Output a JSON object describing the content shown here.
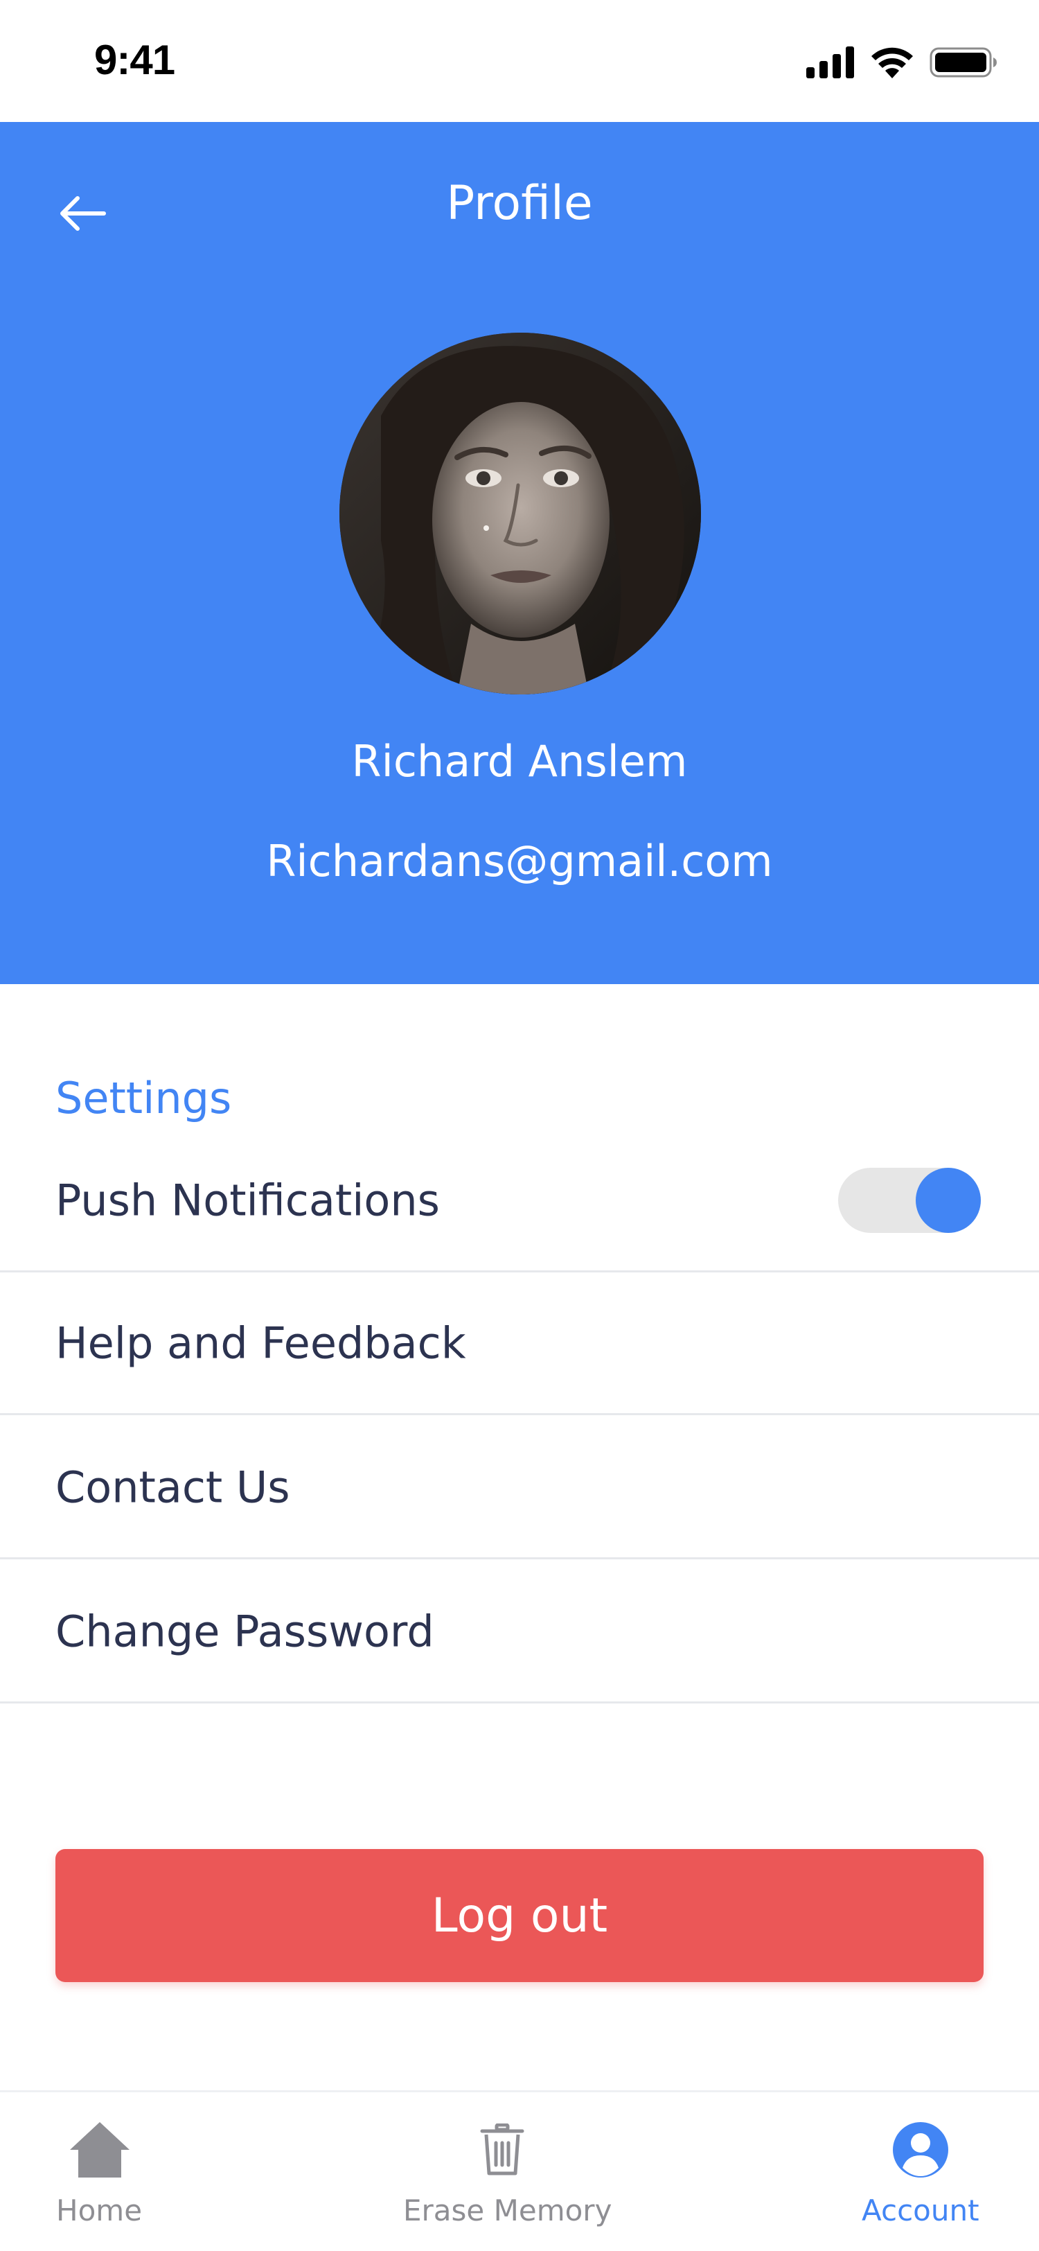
{
  "status_bar": {
    "time": "9:41",
    "icons": [
      "signal-icon",
      "wifi-icon",
      "battery-icon"
    ]
  },
  "header": {
    "title": "Profile",
    "back_icon": "arrow-left-icon",
    "background_color": "#4285f4"
  },
  "profile": {
    "name": "Richard Anslem",
    "email": "Richardans@gmail.com"
  },
  "settings": {
    "heading": "Settings",
    "items": [
      {
        "label": "Push Notifications",
        "type": "toggle",
        "enabled": true
      },
      {
        "label": "Help and Feedback",
        "type": "link"
      },
      {
        "label": "Contact Us",
        "type": "link"
      },
      {
        "label": "Change Password",
        "type": "link"
      }
    ]
  },
  "logout": {
    "label": "Log out",
    "color": "#eb5757"
  },
  "bottom_nav": {
    "active": "Account",
    "active_color": "#4285f4",
    "inactive_color": "#8e8e93",
    "items": [
      {
        "label": "Home",
        "icon": "home-icon"
      },
      {
        "label": "Erase Memory",
        "icon": "trash-icon"
      },
      {
        "label": "Account",
        "icon": "account-icon"
      }
    ]
  }
}
